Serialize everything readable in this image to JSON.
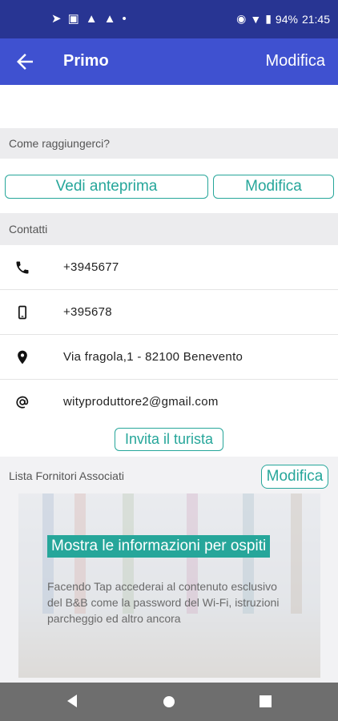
{
  "status_bar": {
    "battery": "94%",
    "time": "21:45"
  },
  "app_bar": {
    "title": "Primo",
    "action": "Modifica"
  },
  "sections": {
    "reach": {
      "header": "Come raggiungerci?",
      "preview_button": "Vedi anteprima",
      "edit_button": "Modifica"
    },
    "contacts": {
      "header": "Contatti",
      "items": [
        {
          "icon": "phone-icon",
          "value": "+3945677"
        },
        {
          "icon": "mobile-icon",
          "value": "+395678"
        },
        {
          "icon": "location-pin-icon",
          "value": "Via fragola,1 - 82100 Benevento"
        },
        {
          "icon": "at-sign-icon",
          "value": "wityproduttore2@gmail.com"
        }
      ],
      "invite_button": "Invita il turista"
    },
    "suppliers": {
      "header": "Lista Fornitori Associati",
      "edit_button": "Modifica",
      "card": {
        "title": "Mostra le informazioni per ospiti",
        "description": "Facendo Tap accederai al contenuto esclusivo del B&B come la password del Wi-Fi, istruzioni parcheggio ed altro ancora"
      }
    }
  },
  "colors": {
    "status_bar": "#283593",
    "app_bar": "#3f51d0",
    "accent": "#26a69a"
  }
}
